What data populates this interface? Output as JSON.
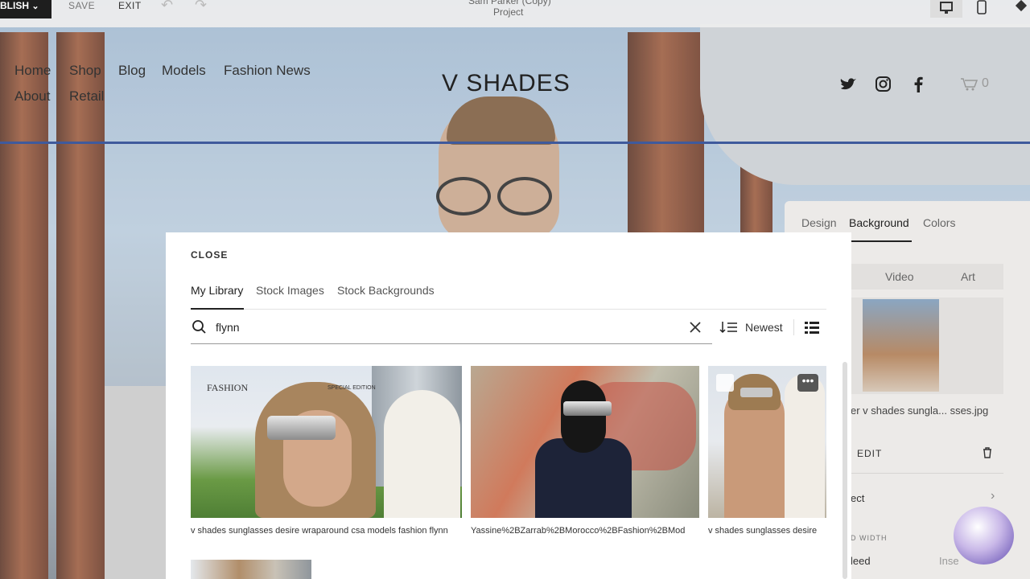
{
  "topbar": {
    "publish": "BLISH",
    "save": "SAVE",
    "exit": "EXIT",
    "title_line1": "Sam Parker (Copy)",
    "title_line2": "Project"
  },
  "site": {
    "nav": [
      "Home",
      "Shop",
      "Blog",
      "Models",
      "Fashion News",
      "About",
      "Retail"
    ],
    "brand": "V SHADES",
    "cart_count": "0"
  },
  "panel": {
    "tabs": [
      "Design",
      "Background",
      "Colors"
    ],
    "active_tab": "Background",
    "subtabs": [
      "Video",
      "Art"
    ],
    "filename": "er v shades sungla... sses.jpg",
    "edit": "EDIT",
    "row1": "ect",
    "section_label": "D WIDTH",
    "row2_left": "leed",
    "row2_right": "Inse"
  },
  "modal": {
    "close": "CLOSE",
    "tabs": [
      "My Library",
      "Stock Images",
      "Stock Backgrounds"
    ],
    "search_value": "flynn",
    "sort_label": "Newest",
    "captions": [
      "v shades sunglasses desire wraparound csa models fashion flynn",
      "Yassine%2BZarrab%2BMorocco%2BFashion%2BMod",
      "v shades sunglasses desire"
    ],
    "thumb1_overlay": "FASHION",
    "thumb1_overlay2": "SPECIAL EDITION"
  },
  "colors": {
    "accent_line": "#3f5a9c",
    "publish_bg": "#1e1e1e"
  }
}
